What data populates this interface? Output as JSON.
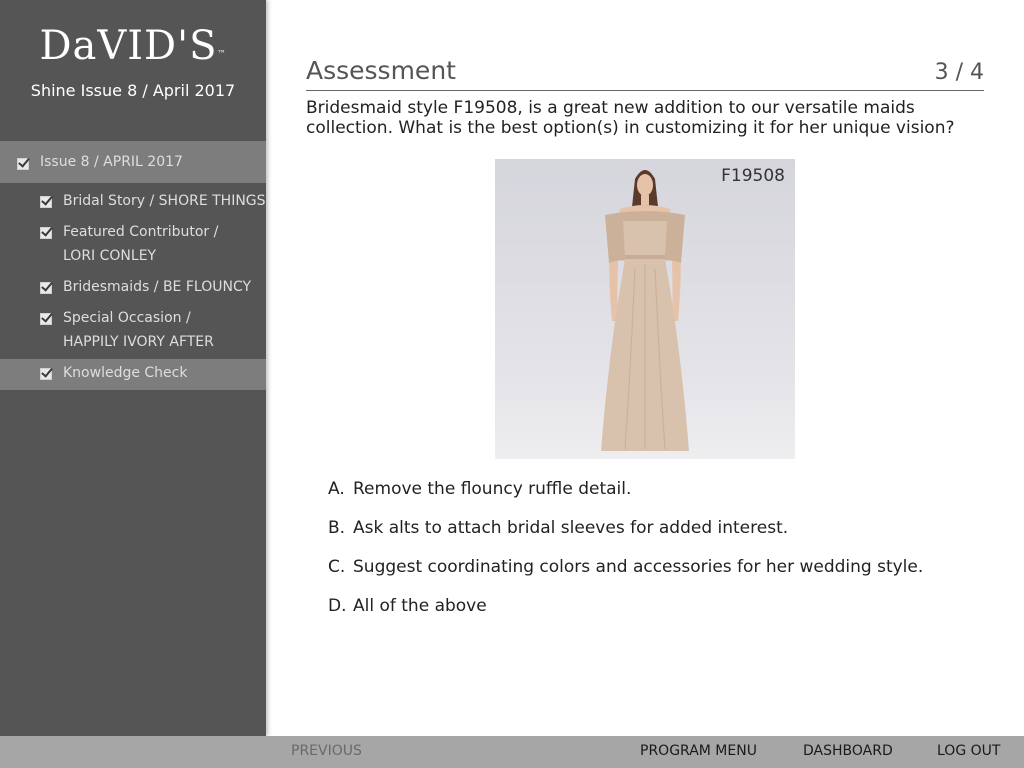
{
  "sidebar": {
    "logo": "DaVID'S",
    "logo_mark": "™",
    "issue_line": "Shine Issue 8 / April 2017",
    "parent_item": {
      "label": "Issue 8 / APRIL 2017"
    },
    "items": [
      {
        "label": "Bridal Story / SHORE THINGS"
      },
      {
        "label": "Featured Contributor /\nLORI CONLEY"
      },
      {
        "label": "Bridesmaids / BE FLOUNCY"
      },
      {
        "label": "Special Occasion /\nHAPPILY IVORY AFTER"
      },
      {
        "label": "Knowledge Check"
      }
    ]
  },
  "main": {
    "title": "Assessment",
    "progress": "3 / 4",
    "question": "Bridesmaid style F19508, is a great new addition to our versatile maids collection. What is the best option(s) in customizing it for her unique vision?",
    "photo_code": "F19508",
    "answers": [
      {
        "letter": "A.",
        "text": "Remove the flouncy ruffle detail."
      },
      {
        "letter": "B.",
        "text": "Ask alts to attach bridal sleeves for added interest."
      },
      {
        "letter": "C.",
        "text": "Suggest coordinating colors and accessories for her wedding style."
      },
      {
        "letter": "D.",
        "text": "All of the above"
      }
    ]
  },
  "footer": {
    "previous": "PREVIOUS",
    "program_menu": "PROGRAM MENU",
    "dashboard": "DASHBOARD",
    "logout": "LOG OUT"
  },
  "colors": {
    "sidebar_bg": "#555555",
    "active_bg": "#7d7d7d",
    "footer_bg": "#a6a6a6",
    "dress": "#d8c2ae"
  }
}
